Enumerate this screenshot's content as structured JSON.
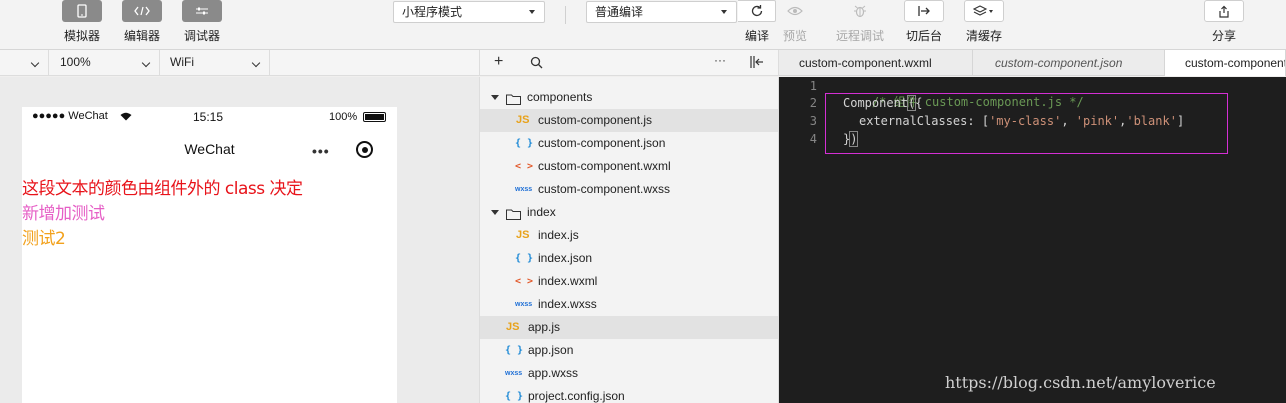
{
  "toolbar": {
    "simulator_label": "模拟器",
    "editor_label": "编辑器",
    "debugger_label": "调试器",
    "mode_select": "小程序模式",
    "compile_select": "普通编译",
    "compile_label": "编译",
    "preview_label": "预览",
    "remote_debug_label": "远程调试",
    "background_label": "切后台",
    "clear_cache_label": "清缓存",
    "share_label": "分享"
  },
  "simulator_bar": {
    "device": "",
    "zoom": "100%",
    "network": "WiFi"
  },
  "phone": {
    "carrier": "●●●●● WeChat",
    "time": "15:15",
    "battery": "100%",
    "nav_title": "WeChat",
    "lines": [
      {
        "text": "这段文本的颜色由组件外的 class 决定",
        "color": "#e8131a"
      },
      {
        "text": "新增加测试",
        "color": "#e65fc6"
      },
      {
        "text": "测试2",
        "color": "#f2a11c"
      }
    ]
  },
  "tree": {
    "items": [
      {
        "label": "components",
        "type": "folder",
        "icon": "folder-icon"
      },
      {
        "label": "custom-component.js",
        "type": "js",
        "icon": "JS"
      },
      {
        "label": "custom-component.json",
        "type": "json",
        "icon": "{ }"
      },
      {
        "label": "custom-component.wxml",
        "type": "wxml",
        "icon": "< >"
      },
      {
        "label": "custom-component.wxss",
        "type": "wxss",
        "icon": "wxss"
      },
      {
        "label": "index",
        "type": "folder",
        "icon": "folder-icon"
      },
      {
        "label": "index.js",
        "type": "js",
        "icon": "JS"
      },
      {
        "label": "index.json",
        "type": "json",
        "icon": "{ }"
      },
      {
        "label": "index.wxml",
        "type": "wxml",
        "icon": "< >"
      },
      {
        "label": "index.wxss",
        "type": "wxss",
        "icon": "wxss"
      },
      {
        "label": "app.js",
        "type": "js",
        "icon": "JS"
      },
      {
        "label": "app.json",
        "type": "json",
        "icon": "{ }"
      },
      {
        "label": "app.wxss",
        "type": "wxss",
        "icon": "wxss"
      },
      {
        "label": "project.config.json",
        "type": "json",
        "icon": "{ }"
      }
    ]
  },
  "tabs": [
    {
      "label": "custom-component.wxml"
    },
    {
      "label": "custom-component.json"
    },
    {
      "label": "custom-component.js"
    }
  ],
  "editor": {
    "line_numbers": [
      "1",
      "2",
      "3",
      "4"
    ],
    "line1": "/* 组件 custom-component.js */",
    "line2_a": "Component",
    "line2_b": "(",
    "line2_c": "{",
    "line3_key": "externalClasses",
    "line3_colon": ": [",
    "line3_s1": "'my-class'",
    "line3_comma1": ", ",
    "line3_s2": "'pink'",
    "line3_comma2": ",",
    "line3_s3": "'blank'",
    "line3_end": "]",
    "line4_a": "}",
    "line4_b": ")"
  },
  "watermark": "https://blog.csdn.net/amyloverice"
}
